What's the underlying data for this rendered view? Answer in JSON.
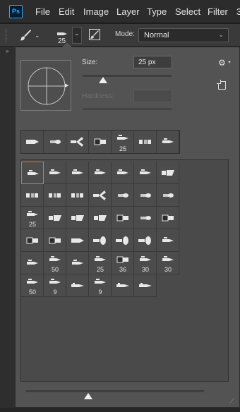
{
  "menubar": {
    "logo": "Ps",
    "items": [
      "File",
      "Edit",
      "Image",
      "Layer",
      "Type",
      "Select",
      "Filter",
      "3"
    ]
  },
  "options_bar": {
    "tool_icon": "brush-icon",
    "brush_size": "25",
    "toggle_icon": "brush-panel-icon",
    "mode_label": "Mode:",
    "mode_value": "Normal"
  },
  "brush_picker": {
    "size_label": "Size:",
    "size_value": "25 px",
    "size_slider_fraction": 0.23,
    "hardness_label": "Hardness:",
    "hardness_value": "",
    "settings_icon": "gear-icon",
    "new_preset_icon": "new-preset-icon",
    "recent_brushes": [
      {
        "icon": "hard-tip-icon",
        "label": ""
      },
      {
        "icon": "soft-tip-icon",
        "label": ""
      },
      {
        "icon": "fan-brush-icon",
        "label": ""
      },
      {
        "icon": "block-tip-icon",
        "label": ""
      },
      {
        "icon": "round-brush-icon",
        "label": "25"
      },
      {
        "icon": "bristle-brush-icon",
        "label": ""
      },
      {
        "icon": "round-brush-icon",
        "label": ""
      }
    ],
    "presets": [
      {
        "icon": "round-brush-icon",
        "label": ""
      },
      {
        "icon": "round-brush-icon",
        "label": ""
      },
      {
        "icon": "round-brush-icon",
        "label": ""
      },
      {
        "icon": "round-brush-icon",
        "label": ""
      },
      {
        "icon": "round-brush-icon",
        "label": ""
      },
      {
        "icon": "round-brush-icon",
        "label": ""
      },
      {
        "icon": "angled-brush-icon",
        "label": ""
      },
      {
        "icon": "bristle-brush-icon",
        "label": ""
      },
      {
        "icon": "bristle-brush-icon",
        "label": ""
      },
      {
        "icon": "bristle-brush-icon",
        "label": ""
      },
      {
        "icon": "fan-brush-icon",
        "label": ""
      },
      {
        "icon": "soft-tip-icon",
        "label": ""
      },
      {
        "icon": "soft-tip-icon",
        "label": ""
      },
      {
        "icon": "soft-tip-icon",
        "label": ""
      },
      {
        "icon": "round-brush-icon",
        "label": "25"
      },
      {
        "icon": "angled-brush-icon",
        "label": ""
      },
      {
        "icon": "angled-brush-icon",
        "label": ""
      },
      {
        "icon": "angled-brush-icon",
        "label": ""
      },
      {
        "icon": "block-tip-icon",
        "label": ""
      },
      {
        "icon": "soft-tip-icon",
        "label": ""
      },
      {
        "icon": "block-tip-icon",
        "label": ""
      },
      {
        "icon": "block-tip-icon",
        "label": ""
      },
      {
        "icon": "block-tip-icon",
        "label": ""
      },
      {
        "icon": "hard-tip-icon",
        "label": ""
      },
      {
        "icon": "bulb-tip-icon",
        "label": ""
      },
      {
        "icon": "bulb-tip-icon",
        "label": ""
      },
      {
        "icon": "bulb-tip-icon",
        "label": ""
      },
      {
        "icon": "round-brush-icon",
        "label": ""
      },
      {
        "icon": "round-brush-icon",
        "label": ""
      },
      {
        "icon": "round-brush-icon",
        "label": "50"
      },
      {
        "icon": "round-brush-icon",
        "label": ""
      },
      {
        "icon": "round-brush-icon",
        "label": "25"
      },
      {
        "icon": "block-tip-icon",
        "label": "36"
      },
      {
        "icon": "round-brush-icon",
        "label": "30"
      },
      {
        "icon": "round-brush-icon",
        "label": "30"
      },
      {
        "icon": "round-brush-icon",
        "label": "50"
      },
      {
        "icon": "round-brush-icon",
        "label": "9"
      },
      {
        "icon": "pencil-tip-icon",
        "label": ""
      },
      {
        "icon": "round-brush-icon",
        "label": "9"
      },
      {
        "icon": "pencil-tip-icon",
        "label": ""
      },
      {
        "icon": "pencil-tip-icon",
        "label": ""
      }
    ],
    "bottom_slider_fraction": 0.35,
    "colors": {
      "selected_border": "#ef6c2e",
      "panel_bg": "#535353",
      "accent": "#31a8ff"
    }
  }
}
